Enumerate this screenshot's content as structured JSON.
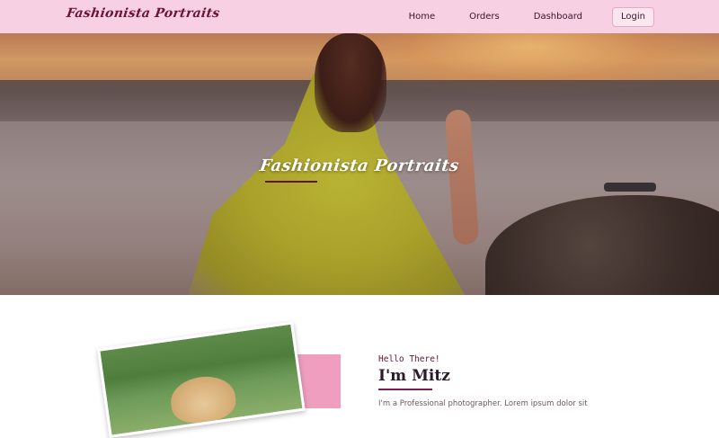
{
  "nav": {
    "brand": "Fashionista Portraits",
    "links": [
      {
        "label": "Home"
      },
      {
        "label": "Orders"
      },
      {
        "label": "Dashboard"
      }
    ],
    "login_label": "Login"
  },
  "hero": {
    "title": "Fashionista Portraits"
  },
  "about": {
    "greeting": "Hello There!",
    "name": "I'm Mitz",
    "bio_partial": "I'm a Professional photographer. Lorem ipsum dolor sit"
  },
  "colors": {
    "navbar_bg": "#f7d0e4",
    "brand_color": "#6b1438",
    "accent": "#7a1f52",
    "pink_block": "#ef9ec0"
  }
}
